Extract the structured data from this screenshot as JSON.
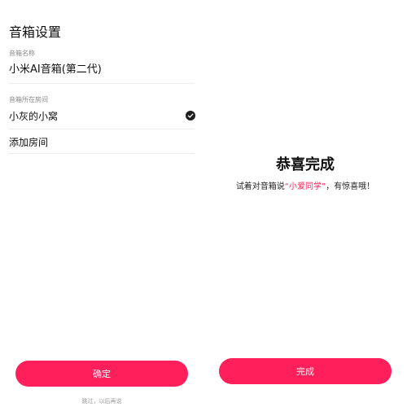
{
  "left": {
    "title": "音箱设置",
    "name_label": "音箱名称",
    "speaker_name": "小米AI音箱(第二代)",
    "room_label": "音箱所在房间",
    "rooms": [
      {
        "label": "小灰的小窝",
        "selected": true
      },
      {
        "label": "添加房间",
        "selected": false
      }
    ],
    "confirm_label": "确定",
    "skip_label": "跳过，以后再说",
    "check_icon": "check-circle-icon"
  },
  "right": {
    "title": "恭喜完成",
    "subtitle_prefix": "试着对音箱说",
    "wake_word": "“小爱同学”",
    "subtitle_suffix": "，有惊喜哦！",
    "done_label": "完成"
  },
  "colors": {
    "accent": "#ff1f5a",
    "text": "#111111",
    "muted": "#8a8a8a",
    "divider": "#ececec"
  }
}
